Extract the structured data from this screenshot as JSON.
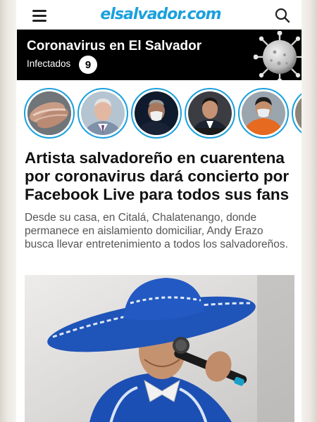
{
  "header": {
    "logo_text": "elsalvador.com",
    "menu_icon": "hamburger-menu-icon",
    "search_icon": "search-icon",
    "brand_color": "#1aa0dc"
  },
  "banner": {
    "title": "Coronavirus en El Salvador",
    "infected_label": "Infectados",
    "infected_count": "9",
    "image": "coronavirus-illustration",
    "background": "#000000"
  },
  "stories": [
    {
      "subject": "hands-washing"
    },
    {
      "subject": "man-with-gray-hair-suit"
    },
    {
      "subject": "man-with-face-mask"
    },
    {
      "subject": "man-in-suit-at-podium"
    },
    {
      "subject": "man-in-orange-jacket-with-mask"
    },
    {
      "subject": "partial-story"
    }
  ],
  "article": {
    "headline": "Artista salvadoreño en cuarentena por coronavirus dará concierto por Facebook Live para todos sus fans",
    "summary": "Desde su casa, en Citalá, Chalatenango, donde permanece en aislamiento domiciliar, Andy Erazo busca llevar entretenimiento a todos los salvadoreños.",
    "image": "mariachi-singer-with-microphone"
  }
}
